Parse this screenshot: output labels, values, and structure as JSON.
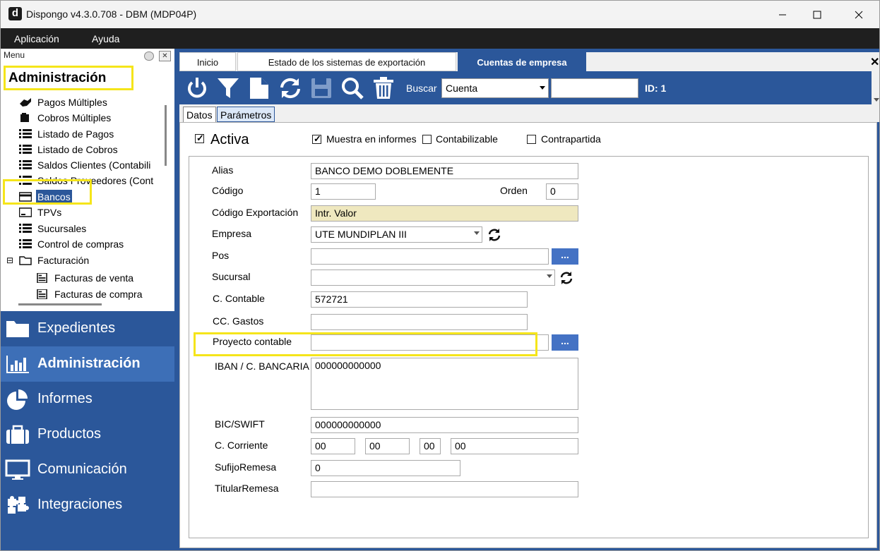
{
  "window": {
    "title": "Dispongo v4.3.0.708 - DBM (MDP04P)",
    "app_icon": "d"
  },
  "menubar": {
    "items": [
      "Aplicación",
      "Ayuda"
    ]
  },
  "sidebar": {
    "header": "Menu",
    "section": "Administración",
    "tree": [
      {
        "label": "Pagos Múltiples",
        "icon": "payments-icon"
      },
      {
        "label": "Cobros Múltiples",
        "icon": "collections-icon"
      },
      {
        "label": "Listado de Pagos",
        "icon": "list-icon"
      },
      {
        "label": "Listado de Cobros",
        "icon": "list-icon"
      },
      {
        "label": "Saldos Clientes (Contabili",
        "icon": "list-icon"
      },
      {
        "label": "Saldos Proveedores (Cont",
        "icon": "list-icon"
      },
      {
        "label": "Bancos",
        "icon": "card-icon",
        "selected": true
      },
      {
        "label": "TPVs",
        "icon": "pos-icon"
      },
      {
        "label": "Sucursales",
        "icon": "list-icon"
      },
      {
        "label": "Control de compras",
        "icon": "list-icon"
      },
      {
        "label": "Facturación",
        "icon": "folder-icon",
        "expander": "⊟"
      },
      {
        "label": "Facturas de venta",
        "icon": "invoice-icon"
      },
      {
        "label": "Facturas de compra",
        "icon": "invoice-icon"
      }
    ],
    "nav": [
      {
        "label": "Expedientes",
        "icon": "folder-icon"
      },
      {
        "label": "Administración",
        "icon": "chart-icon",
        "active": true
      },
      {
        "label": "Informes",
        "icon": "pie-chart-icon"
      },
      {
        "label": "Productos",
        "icon": "briefcase-icon"
      },
      {
        "label": "Comunicación",
        "icon": "monitor-icon"
      },
      {
        "label": "Integraciones",
        "icon": "puzzle-icon"
      }
    ]
  },
  "tabs": [
    {
      "label": "Inicio"
    },
    {
      "label": "Estado de los sistemas de exportación"
    },
    {
      "label": "Cuentas de empresa",
      "active": true
    }
  ],
  "toolbar": {
    "buscar_label": "Buscar",
    "buscar_field": "Cuenta",
    "buscar_value": "",
    "id_label": "ID: 1"
  },
  "subtabs": [
    "Datos",
    "Parámetros"
  ],
  "form": {
    "activa_label": "Activa",
    "activa_checked": true,
    "muestra_label": "Muestra en informes",
    "muestra_checked": true,
    "contabilizable_label": "Contabilizable",
    "contrapartida_label": "Contrapartida",
    "alias_label": "Alias",
    "alias_value": "BANCO DEMO DOBLEMENTE",
    "codigo_label": "Código",
    "codigo_value": "1",
    "orden_label": "Orden",
    "orden_value": "0",
    "codexp_label": "Código Exportación",
    "codexp_value": "Intr. Valor",
    "empresa_label": "Empresa",
    "empresa_value": "UTE MUNDIPLAN III",
    "pos_label": "Pos",
    "pos_value": "",
    "sucursal_label": "Sucursal",
    "sucursal_value": "",
    "ccontable_label": "C. Contable",
    "ccontable_value": "572721",
    "ccgastos_label": "CC. Gastos",
    "ccgastos_value": "",
    "proyecto_label": "Proyecto contable",
    "proyecto_value": "",
    "iban_label": "IBAN / C. BANCARIA",
    "iban_value": "000000000000",
    "bic_label": "BIC/SWIFT",
    "bic_value": "000000000000",
    "ccorriente_label": "C. Corriente",
    "ccorriente_values": [
      "00",
      "00",
      "00",
      "00"
    ],
    "sufijo_label": "SufijoRemesa",
    "sufijo_value": "0",
    "titular_label": "TitularRemesa",
    "titular_value": "",
    "dots": "..."
  },
  "colors": {
    "accent": "#2b579a",
    "highlight": "#f5e51a",
    "readonly": "#efe8bf"
  }
}
